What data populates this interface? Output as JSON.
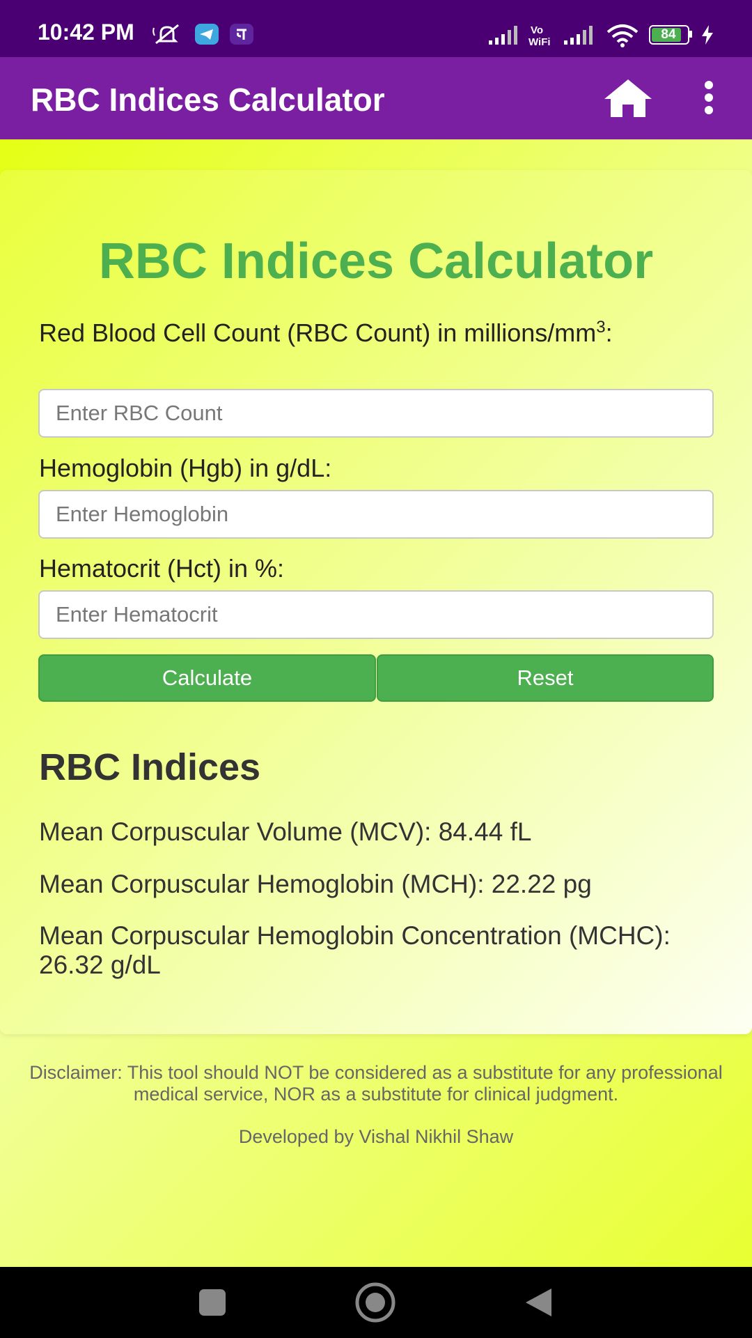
{
  "status_bar": {
    "time": "10:42 PM",
    "battery_level": "84",
    "icons": [
      "mute-icon",
      "telegram-icon",
      "phonepe-icon",
      "signal-icon",
      "vowifi-icon",
      "signal-icon",
      "wifi-icon",
      "battery-icon",
      "charging-icon"
    ]
  },
  "app_bar": {
    "title": "RBC Indices Calculator",
    "icons": [
      "home-icon",
      "more-vertical-icon"
    ]
  },
  "calculator": {
    "title": "RBC Indices Calculator",
    "rbc": {
      "label": "Red Blood Cell Count (RBC Count) in millions/mm",
      "label_sup": "3",
      "label_suffix": ":",
      "placeholder": "Enter RBC Count"
    },
    "hgb": {
      "label": "Hemoglobin (Hgb) in g/dL:",
      "placeholder": "Enter Hemoglobin"
    },
    "hct": {
      "label": "Hematocrit (Hct) in %:",
      "placeholder": "Enter Hematocrit"
    },
    "calculate_label": "Calculate",
    "reset_label": "Reset"
  },
  "results": {
    "heading": "RBC Indices",
    "mcv": "Mean Corpuscular Volume (MCV): 84.44 fL",
    "mch": "Mean Corpuscular Hemoglobin (MCH): 22.22 pg",
    "mchc": "Mean Corpuscular Hemoglobin Concentration (MCHC): 26.32 g/dL"
  },
  "footer": {
    "disclaimer": "Disclaimer: This tool should NOT be considered as a substitute for any professional medical service, NOR as a substitute for clinical judgment.",
    "developer": "Developed by Vishal Nikhil Shaw"
  },
  "nav_bar": {
    "icons": [
      "recents-icon",
      "home-circle-icon",
      "back-icon"
    ]
  },
  "colors": {
    "status_bar": "#4a0073",
    "app_bar": "#7b1fa2",
    "accent_green": "#4caf50",
    "background_yellow": "#e3ff00"
  }
}
